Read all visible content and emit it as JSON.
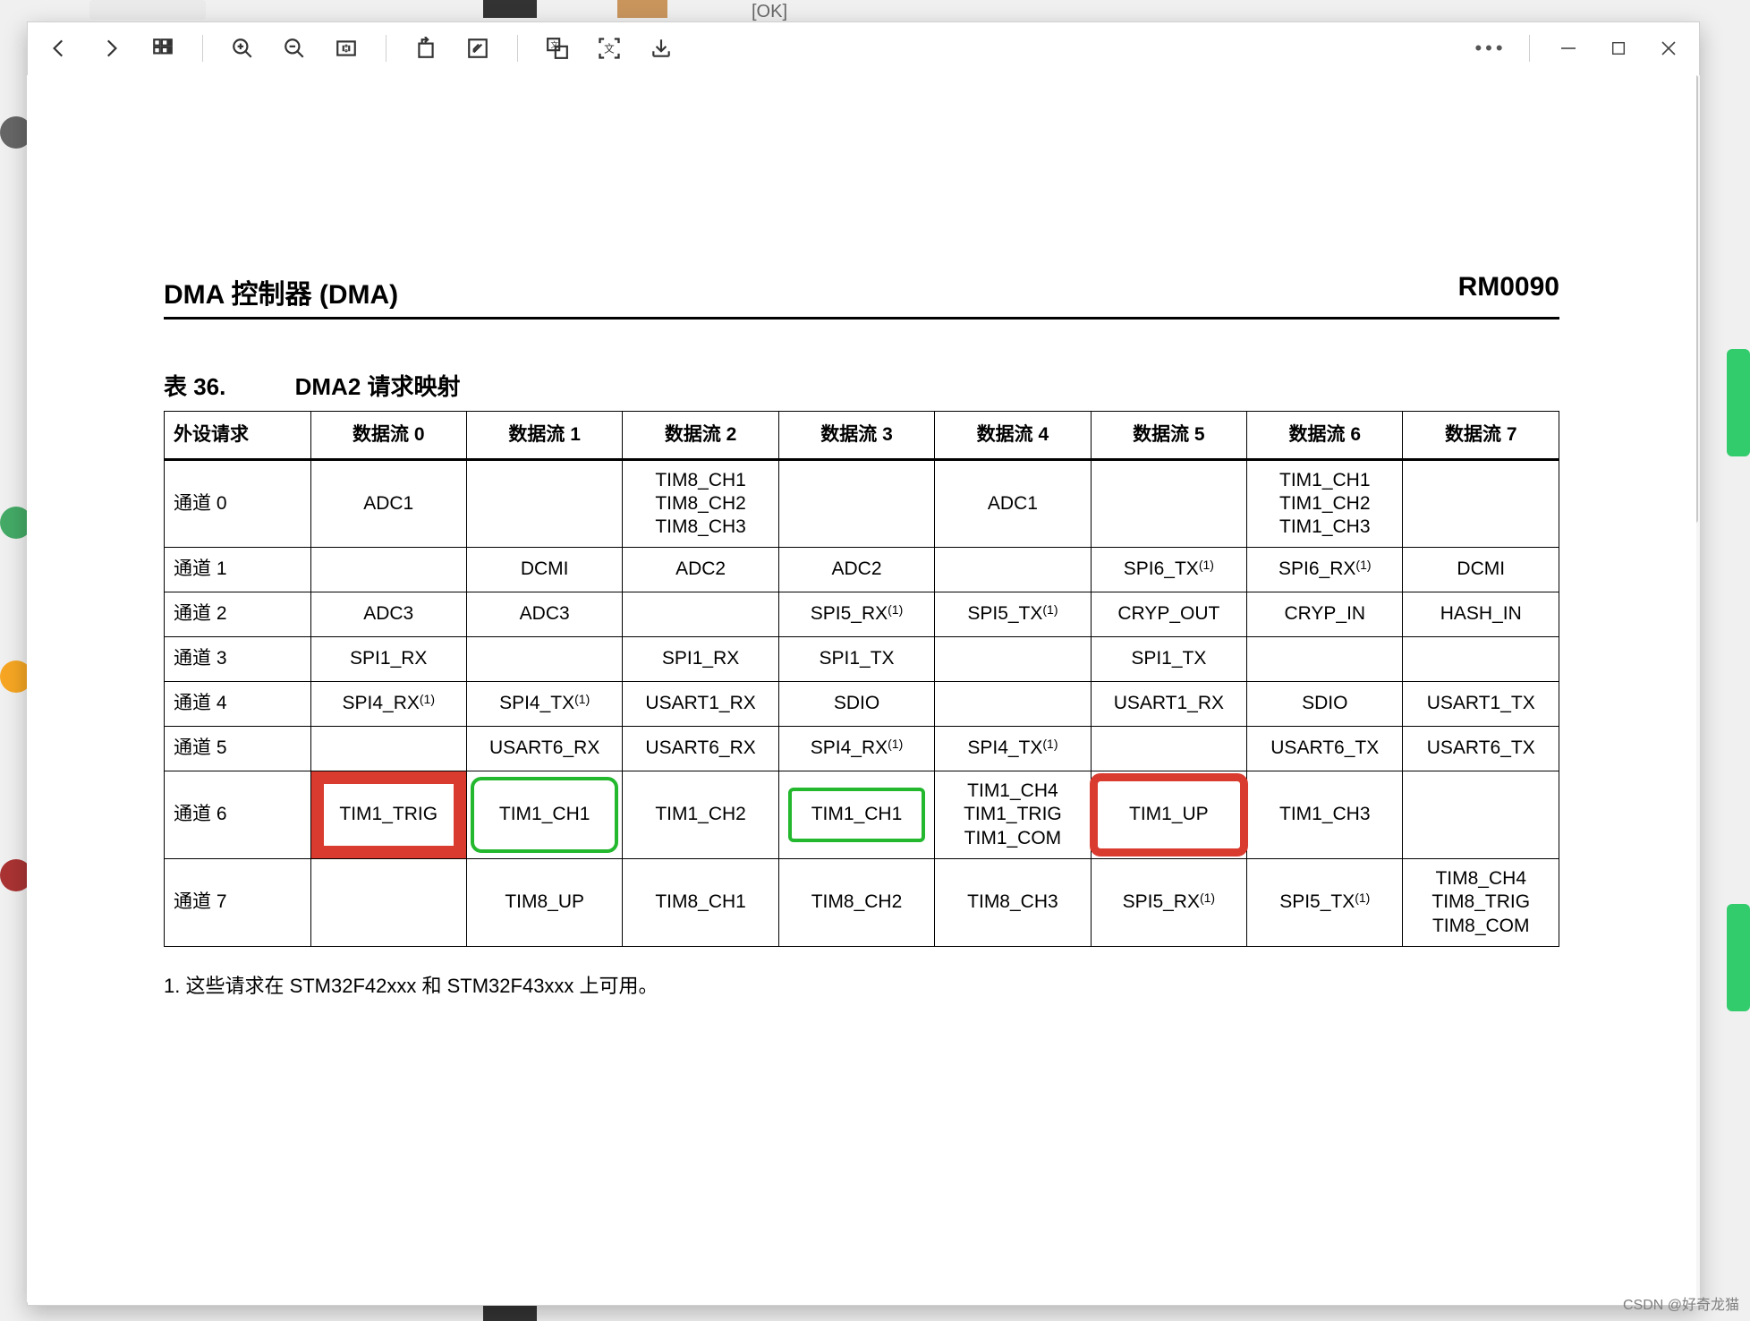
{
  "doc": {
    "header_left": "DMA 控制器 (DMA)",
    "header_right": "RM0090",
    "table_number": "表 36.",
    "table_name": "DMA2 请求映射",
    "columns": [
      "外设请求",
      "数据流 0",
      "数据流 1",
      "数据流 2",
      "数据流 3",
      "数据流 4",
      "数据流 5",
      "数据流 6",
      "数据流 7"
    ],
    "rows": [
      {
        "label": "通道 0",
        "cells": [
          "ADC1",
          "",
          "TIM8_CH1\nTIM8_CH2\nTIM8_CH3",
          "",
          "ADC1",
          "",
          "TIM1_CH1\nTIM1_CH2\nTIM1_CH3",
          ""
        ]
      },
      {
        "label": "通道 1",
        "cells": [
          "",
          "DCMI",
          "ADC2",
          "ADC2",
          "",
          "SPI6_TX^(1)",
          "SPI6_RX^(1)",
          "DCMI"
        ]
      },
      {
        "label": "通道 2",
        "cells": [
          "ADC3",
          "ADC3",
          "",
          "SPI5_RX^(1)",
          "SPI5_TX^(1)",
          "CRYP_OUT",
          "CRYP_IN",
          "HASH_IN"
        ]
      },
      {
        "label": "通道 3",
        "cells": [
          "SPI1_RX",
          "",
          "SPI1_RX",
          "SPI1_TX",
          "",
          "SPI1_TX",
          "",
          ""
        ]
      },
      {
        "label": "通道 4",
        "cells": [
          "SPI4_RX^(1)",
          "SPI4_TX^(1)",
          "USART1_RX",
          "SDIO",
          "",
          "USART1_RX",
          "SDIO",
          "USART1_TX"
        ]
      },
      {
        "label": "通道 5",
        "cells": [
          "",
          "USART6_RX",
          "USART6_RX",
          "SPI4_RX^(1)",
          "SPI4_TX^(1)",
          "",
          "USART6_TX",
          "USART6_TX"
        ]
      },
      {
        "label": "通道 6",
        "cells": [
          "TIM1_TRIG",
          "TIM1_CH1",
          "TIM1_CH2",
          "TIM1_CH1",
          "TIM1_CH4\nTIM1_TRIG\nTIM1_COM",
          "TIM1_UP",
          "TIM1_CH3",
          ""
        ]
      },
      {
        "label": "通道 7",
        "cells": [
          "",
          "TIM8_UP",
          "TIM8_CH1",
          "TIM8_CH2",
          "TIM8_CH3",
          "SPI5_RX^(1)",
          "SPI5_TX^(1)",
          "TIM8_CH4\nTIM8_TRIG\nTIM8_COM"
        ]
      }
    ],
    "footnote": "1.   这些请求在 STM32F42xxx 和 STM32F43xxx 上可用。"
  },
  "misc": {
    "ok_bubble": "[OK]",
    "watermark": "CSDN @好奇龙猫"
  }
}
